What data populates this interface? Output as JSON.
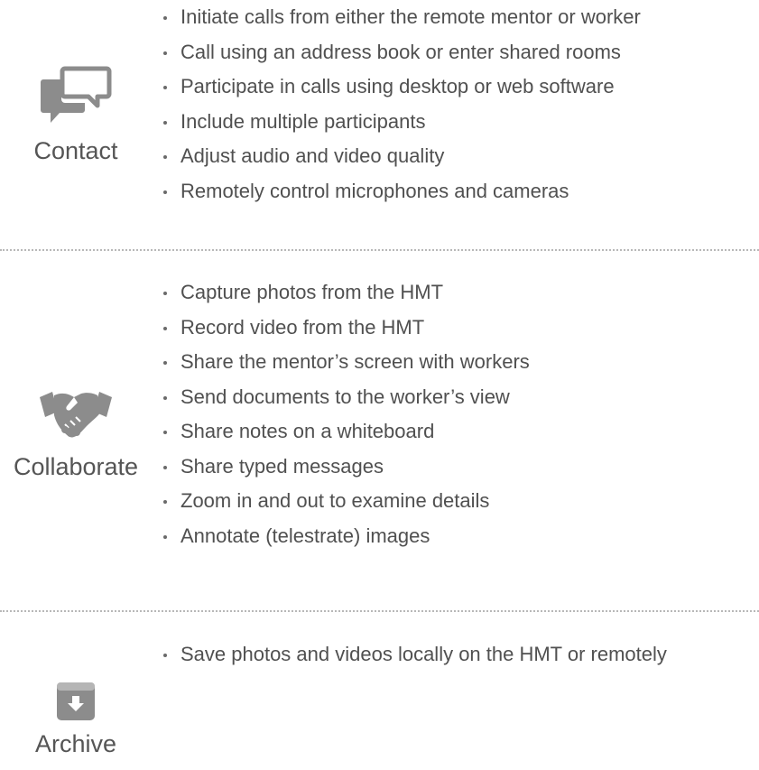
{
  "sections": [
    {
      "title": "Contact",
      "icon": "chat-bubbles-icon",
      "items": [
        "Initiate calls from either the remote mentor or worker",
        "Call using an address book or enter shared rooms",
        "Participate in calls using desktop or web software",
        "Include multiple participants",
        "Adjust audio and video quality",
        "Remotely control microphones and cameras"
      ]
    },
    {
      "title": "Collaborate",
      "icon": "handshake-icon",
      "items": [
        "Capture photos from the HMT",
        "Record video from the HMT",
        "Share the mentor’s screen with workers",
        "Send documents to the worker’s view",
        "Share notes on a whiteboard",
        "Share typed messages",
        "Zoom in and out to examine details",
        "Annotate (telestrate) images"
      ]
    },
    {
      "title": "Archive",
      "icon": "archive-box-icon",
      "items": [
        "Save photos and videos locally on the HMT or remotely"
      ]
    }
  ],
  "colors": {
    "text": "#505050",
    "icon": "#8c8c8c",
    "divider": "#b8b8b8"
  }
}
